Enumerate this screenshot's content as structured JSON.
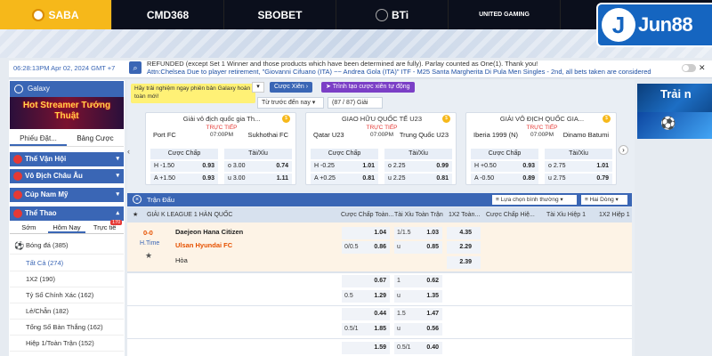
{
  "providers": [
    "SABA",
    "CMD368",
    "SBOBET",
    "BTi",
    "UNITED GAMING"
  ],
  "brand": "Jun88",
  "infobar": {
    "time": "06:28:13PM Apr 02, 2024 GMT +7",
    "ticker_line1": "REFUNDED (except Set 1 Winner and those products which have been determined are fully). Parlay counted as One(1). Thank you!",
    "ticker_line2": "Attn:Chelsea Due to player retirement, \"Giovanni Cifuano (ITA) ~~ Andrea Gola (ITA)\" ITF - M25 Santa Margherita Di Pula Men Singles - 2nd, all bets taken are considered"
  },
  "sidebar": {
    "galaxy": "Galaxy",
    "promo": "Hot Streamer Tướng Thuật",
    "betslip_tabs": [
      "Phiếu Đặt...",
      "Bảng Cược"
    ],
    "sections": [
      {
        "label": "Thế Vận Hội"
      },
      {
        "label": "Vô Địch Châu Âu"
      },
      {
        "label": "Cúp Nam Mỹ"
      },
      {
        "label": "Thể Thao"
      }
    ],
    "time_tabs": [
      "Sớm",
      "Hôm Nay",
      "Trực tiế"
    ],
    "live_count": "170",
    "football": "Bóng đá",
    "football_count": "(385)",
    "items": [
      {
        "label": "Tất Cả",
        "count": "(274)"
      },
      {
        "label": "1X2",
        "count": "(190)"
      },
      {
        "label": "Tỷ Số Chính Xác",
        "count": "(162)"
      },
      {
        "label": "Lẻ/Chẵn",
        "count": "(182)"
      },
      {
        "label": "Tổng Số Bàn Thắng",
        "count": "(162)"
      },
      {
        "label": "Hiệp 1/Toàn Trận",
        "count": "(152)"
      }
    ]
  },
  "center": {
    "tip": "Hãy trải nghiệm ngay phiên bản Galaxy hoàn toàn mới!",
    "btn_parlay": "Cược Xiên",
    "btn_create": "Trình tạo cược xiên tự động",
    "sel_sort": "Từ trước đến nay",
    "sel_count": "(87 / 87) Giải",
    "cards": [
      {
        "league": "Giải vô địch quốc gia Th...",
        "home": "Port FC",
        "away": "Sukhothai FC",
        "live": "TRỰC TIẾP",
        "time": "07:00PM",
        "hdp_h": "H -1.50",
        "hdp_h_o": "0.93",
        "hdp_a": "A +1.50",
        "hdp_a_o": "0.93",
        "ou_o": "o 3.00",
        "ou_o_v": "0.74",
        "ou_u": "u 3.00",
        "ou_u_v": "1.11"
      },
      {
        "league": "GIAO HỮU QUỐC TẾ U23",
        "home": "Qatar U23",
        "away": "Trung Quốc U23",
        "live": "TRỰC TIẾP",
        "time": "07:00PM",
        "hdp_h": "H -0.25",
        "hdp_h_o": "1.01",
        "hdp_a": "A +0.25",
        "hdp_a_o": "0.81",
        "ou_o": "o 2.25",
        "ou_o_v": "0.99",
        "ou_u": "u 2.25",
        "ou_u_v": "0.81"
      },
      {
        "league": "GIẢI VÔ ĐỊCH QUỐC GIA...",
        "home": "Iberia 1999 (N)",
        "away": "Dinamo Batumi",
        "live": "TRỰC TIẾP",
        "time": "07:00PM",
        "hdp_h": "H +0.50",
        "hdp_h_o": "0.93",
        "hdp_a": "A -0.50",
        "hdp_a_o": "0.89",
        "ou_o": "o 2.75",
        "ou_o_v": "1.01",
        "ou_u": "u 2.75",
        "ou_u_v": "0.79"
      }
    ],
    "col_hdp": "Cược Chấp",
    "col_ou": "Tài/Xỉu",
    "table_title": "Trận Đấu",
    "filter1": "Lựa chọn bình thường",
    "filter2": "Hai Dòng",
    "columns": [
      "GIẢI K LEAGUE 1 HÀN QUỐC",
      "Cược Chấp Toàn...",
      "Tài Xỉu Toàn Trận",
      "1X2 Toàn...",
      "Cược Chấp Hiệ...",
      "Tài Xỉu Hiệp 1",
      "1X2 Hiệp 1"
    ],
    "match": {
      "score": "0-0",
      "status": "H.Time",
      "home": "Daejeon Hana Citizen",
      "away": "Ulsan Hyundai FC",
      "draw": "Hòa"
    },
    "rows": [
      {
        "hdp_l1": "",
        "hdp_v1": "1.04",
        "ou_l1": "1/1.5",
        "ou_v1": "1.03",
        "x_v1": "4.35",
        "hdp_l2": "0/0.5",
        "hdp_v2": "0.86",
        "ou_l2": "u",
        "ou_v2": "0.85",
        "x_v2": "2.29",
        "x_v3": "2.39"
      },
      {
        "hdp_l1": "",
        "hdp_v1": "0.67",
        "ou_l1": "1",
        "ou_v1": "0.62",
        "hdp_l2": "0.5",
        "hdp_v2": "1.29",
        "ou_l2": "u",
        "ou_v2": "1.35"
      },
      {
        "hdp_l1": "",
        "hdp_v1": "0.44",
        "ou_l1": "1.5",
        "ou_v1": "1.47",
        "hdp_l2": "0.5/1",
        "hdp_v2": "1.85",
        "ou_l2": "u",
        "ou_v2": "0.56"
      },
      {
        "hdp_l1": "",
        "hdp_v1": "1.59",
        "ou_l1": "0.5/1",
        "ou_v1": "0.40"
      }
    ]
  },
  "ads": [
    "Trải n",
    ""
  ]
}
